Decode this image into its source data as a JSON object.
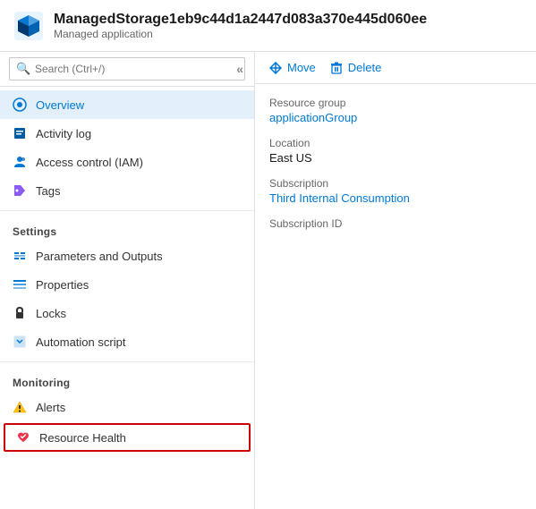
{
  "header": {
    "title": "ManagedStorage1eb9c44d1a2447d083a370e445d060ee",
    "subtitle": "Managed application",
    "icon_color": "#0078d4"
  },
  "sidebar": {
    "search_placeholder": "Search (Ctrl+/)",
    "nav_items": [
      {
        "id": "overview",
        "label": "Overview",
        "active": true
      },
      {
        "id": "activity-log",
        "label": "Activity log",
        "active": false
      },
      {
        "id": "access-control",
        "label": "Access control (IAM)",
        "active": false
      },
      {
        "id": "tags",
        "label": "Tags",
        "active": false
      }
    ],
    "sections": [
      {
        "label": "Settings",
        "items": [
          {
            "id": "parameters-outputs",
            "label": "Parameters and Outputs",
            "active": false
          },
          {
            "id": "properties",
            "label": "Properties",
            "active": false
          },
          {
            "id": "locks",
            "label": "Locks",
            "active": false
          },
          {
            "id": "automation-script",
            "label": "Automation script",
            "active": false
          }
        ]
      },
      {
        "label": "Monitoring",
        "items": [
          {
            "id": "alerts",
            "label": "Alerts",
            "active": false
          },
          {
            "id": "resource-health",
            "label": "Resource Health",
            "active": false,
            "highlighted": true
          }
        ]
      }
    ]
  },
  "toolbar": {
    "move_label": "Move",
    "delete_label": "Delete"
  },
  "info": {
    "resource_group_label": "Resource group",
    "resource_group_value": "applicationGroup",
    "location_label": "Location",
    "location_value": "East US",
    "subscription_label": "Subscription",
    "subscription_value": "Third Internal Consumption",
    "subscription_id_label": "Subscription ID",
    "subscription_id_value": ""
  }
}
